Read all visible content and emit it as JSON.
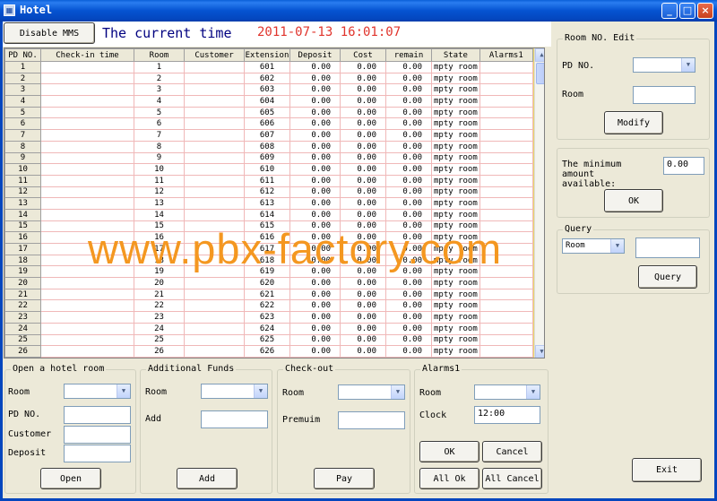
{
  "window": {
    "title": "Hotel",
    "icon": "app-icon",
    "controls": [
      "_",
      "□",
      "X"
    ]
  },
  "header": {
    "disable_button": "Disable MMS",
    "current_time_label": "The current time",
    "current_time_value": "2011-07-13 16:01:07"
  },
  "grid": {
    "columns": [
      "PD NO.",
      "Check-in time",
      "Room",
      "Customer",
      "Extension",
      "Deposit",
      "Cost",
      "remain",
      "State",
      "Alarms1"
    ],
    "rows": [
      [
        "1",
        "",
        "1",
        "",
        "601",
        "0.00",
        "0.00",
        "0.00",
        "mpty room",
        ""
      ],
      [
        "2",
        "",
        "2",
        "",
        "602",
        "0.00",
        "0.00",
        "0.00",
        "mpty room",
        ""
      ],
      [
        "3",
        "",
        "3",
        "",
        "603",
        "0.00",
        "0.00",
        "0.00",
        "mpty room",
        ""
      ],
      [
        "4",
        "",
        "4",
        "",
        "604",
        "0.00",
        "0.00",
        "0.00",
        "mpty room",
        ""
      ],
      [
        "5",
        "",
        "5",
        "",
        "605",
        "0.00",
        "0.00",
        "0.00",
        "mpty room",
        ""
      ],
      [
        "6",
        "",
        "6",
        "",
        "606",
        "0.00",
        "0.00",
        "0.00",
        "mpty room",
        ""
      ],
      [
        "7",
        "",
        "7",
        "",
        "607",
        "0.00",
        "0.00",
        "0.00",
        "mpty room",
        ""
      ],
      [
        "8",
        "",
        "8",
        "",
        "608",
        "0.00",
        "0.00",
        "0.00",
        "mpty room",
        ""
      ],
      [
        "9",
        "",
        "9",
        "",
        "609",
        "0.00",
        "0.00",
        "0.00",
        "mpty room",
        ""
      ],
      [
        "10",
        "",
        "10",
        "",
        "610",
        "0.00",
        "0.00",
        "0.00",
        "mpty room",
        ""
      ],
      [
        "11",
        "",
        "11",
        "",
        "611",
        "0.00",
        "0.00",
        "0.00",
        "mpty room",
        ""
      ],
      [
        "12",
        "",
        "12",
        "",
        "612",
        "0.00",
        "0.00",
        "0.00",
        "mpty room",
        ""
      ],
      [
        "13",
        "",
        "13",
        "",
        "613",
        "0.00",
        "0.00",
        "0.00",
        "mpty room",
        ""
      ],
      [
        "14",
        "",
        "14",
        "",
        "614",
        "0.00",
        "0.00",
        "0.00",
        "mpty room",
        ""
      ],
      [
        "15",
        "",
        "15",
        "",
        "615",
        "0.00",
        "0.00",
        "0.00",
        "mpty room",
        ""
      ],
      [
        "16",
        "",
        "16",
        "",
        "616",
        "0.00",
        "0.00",
        "0.00",
        "mpty room",
        ""
      ],
      [
        "17",
        "",
        "17",
        "",
        "617",
        "0.00",
        "0.00",
        "0.00",
        "mpty room",
        ""
      ],
      [
        "18",
        "",
        "18",
        "",
        "618",
        "0.00",
        "0.00",
        "0.00",
        "mpty room",
        ""
      ],
      [
        "19",
        "",
        "19",
        "",
        "619",
        "0.00",
        "0.00",
        "0.00",
        "mpty room",
        ""
      ],
      [
        "20",
        "",
        "20",
        "",
        "620",
        "0.00",
        "0.00",
        "0.00",
        "mpty room",
        ""
      ],
      [
        "21",
        "",
        "21",
        "",
        "621",
        "0.00",
        "0.00",
        "0.00",
        "mpty room",
        ""
      ],
      [
        "22",
        "",
        "22",
        "",
        "622",
        "0.00",
        "0.00",
        "0.00",
        "mpty room",
        ""
      ],
      [
        "23",
        "",
        "23",
        "",
        "623",
        "0.00",
        "0.00",
        "0.00",
        "mpty room",
        ""
      ],
      [
        "24",
        "",
        "24",
        "",
        "624",
        "0.00",
        "0.00",
        "0.00",
        "mpty room",
        ""
      ],
      [
        "25",
        "",
        "25",
        "",
        "625",
        "0.00",
        "0.00",
        "0.00",
        "mpty room",
        ""
      ],
      [
        "26",
        "",
        "26",
        "",
        "626",
        "0.00",
        "0.00",
        "0.00",
        "mpty room",
        ""
      ]
    ]
  },
  "watermark": "www.pbx-factory.com",
  "open_room": {
    "title": "Open a hotel room",
    "room_label": "Room",
    "pd_label": "PD NO.",
    "customer_label": "Customer",
    "deposit_label": "Deposit",
    "button": "Open"
  },
  "additional_funds": {
    "title": "Additional Funds",
    "room_label": "Room",
    "add_label": "Add",
    "button": "Add"
  },
  "checkout": {
    "title": "Check-out",
    "room_label": "Room",
    "premium_label": "Premuim",
    "button": "Pay"
  },
  "alarms": {
    "title": "Alarms1",
    "room_label": "Room",
    "clock_label": "Clock",
    "clock_value": "12:00",
    "ok": "OK",
    "cancel": "Cancel",
    "all_ok": "All Ok",
    "all_cancel": "All Cancel"
  },
  "room_edit": {
    "title": "Room NO. Edit",
    "pd_label": "PD NO.",
    "room_label": "Room",
    "button": "Modify"
  },
  "minimum": {
    "label": "The minimum amount available:",
    "value": "0.00",
    "button": "OK"
  },
  "query": {
    "title": "Query",
    "select_value": "Room",
    "button": "Query"
  },
  "exit_button": "Exit"
}
